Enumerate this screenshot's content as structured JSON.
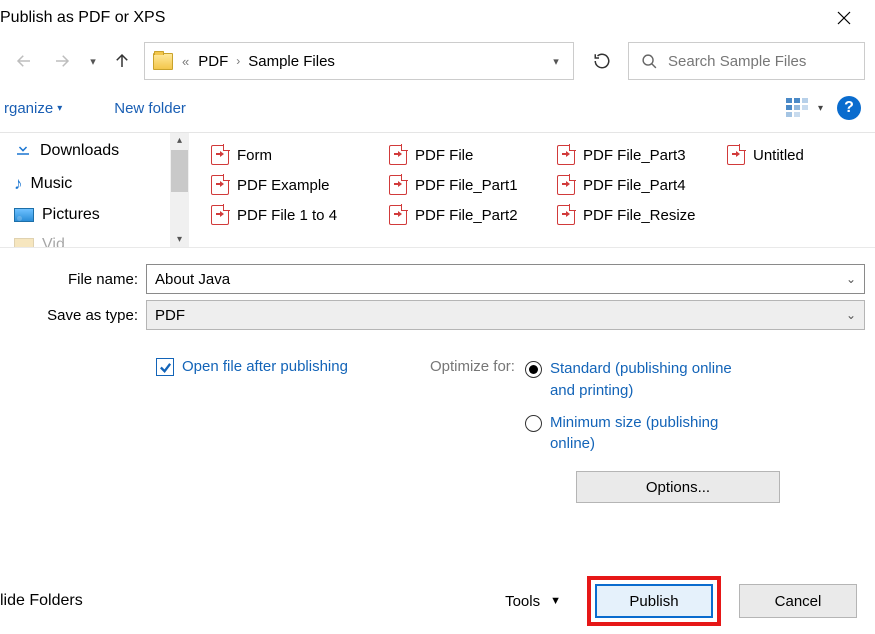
{
  "title": "Publish as PDF or XPS",
  "breadcrumb": {
    "seg1": "PDF",
    "seg2": "Sample Files"
  },
  "search": {
    "placeholder": "Search Sample Files"
  },
  "toolbar": {
    "organize": "rganize",
    "new_folder": "New folder"
  },
  "sidebar": {
    "items": [
      "Downloads",
      "Music",
      "Pictures",
      "Vid"
    ]
  },
  "files": {
    "col1": [
      "Form",
      "PDF Example",
      "PDF File 1 to 4"
    ],
    "col2": [
      "PDF File",
      "PDF File_Part1",
      "PDF File_Part2"
    ],
    "col3": [
      "PDF File_Part3",
      "PDF File_Part4",
      "PDF File_Resize"
    ],
    "col4": [
      "Untitled"
    ]
  },
  "form": {
    "file_name_label": "File name:",
    "file_name_value": "About Java",
    "save_type_label": "Save as type:",
    "save_type_value": "PDF",
    "open_after": "Open file after publishing",
    "optimize_label": "Optimize for:",
    "opt_standard": "Standard (publishing online and printing)",
    "opt_min": "Minimum size (publishing online)",
    "options_btn": "Options..."
  },
  "footer": {
    "hide": "lide Folders",
    "tools": "Tools",
    "publish": "Publish",
    "cancel": "Cancel"
  }
}
